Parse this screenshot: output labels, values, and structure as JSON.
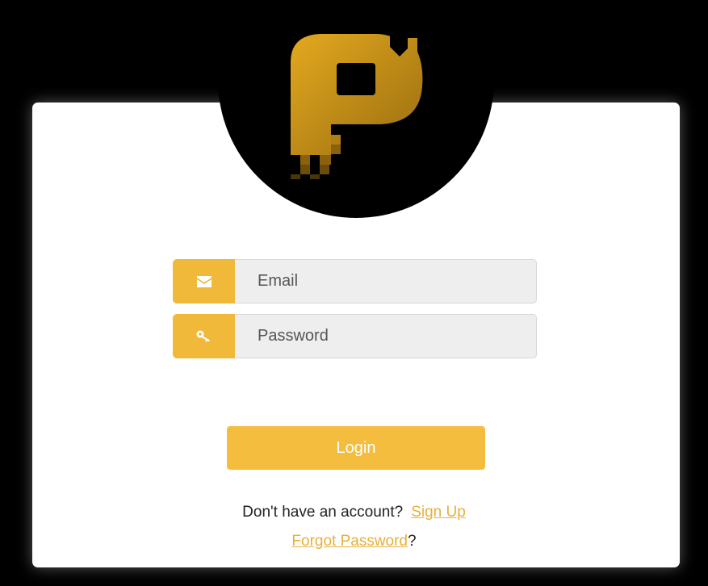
{
  "brand": {
    "logo_icon": "p-logo-icon",
    "accent_color": "#f0b93a",
    "gold_color": "#c9961a"
  },
  "form": {
    "email_placeholder": "Email",
    "email_icon": "envelope-icon",
    "password_placeholder": "Password",
    "password_icon": "key-icon",
    "login_label": "Login"
  },
  "footer": {
    "no_account_text": "Don't have an account?",
    "signup_label": "Sign Up",
    "forgot_label": "Forgot Password",
    "forgot_suffix": "?"
  }
}
